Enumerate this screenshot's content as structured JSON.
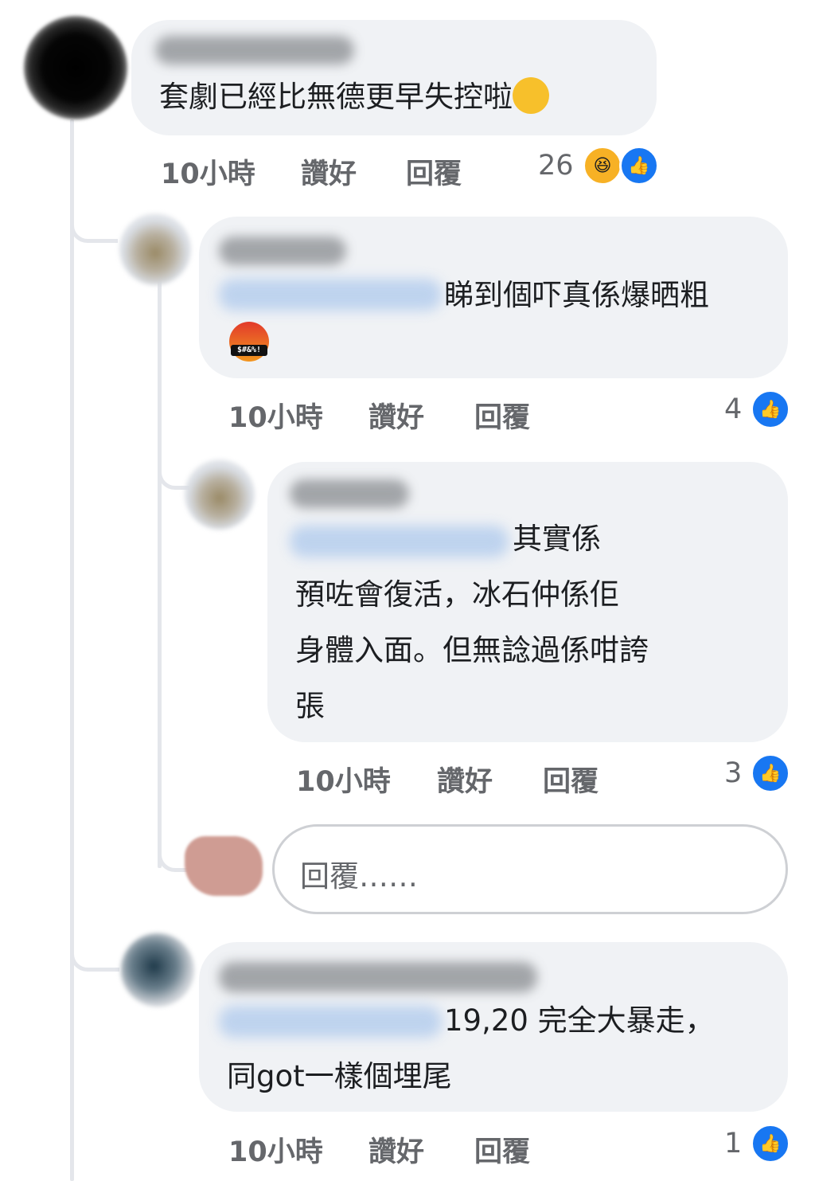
{
  "comments": [
    {
      "text_lines": [
        "套劇已經比無德更早失控啦"
      ],
      "trailing_emoji": "rolling-on-floor-laughing",
      "time": "10小時",
      "like_label": "讚好",
      "reply_label": "回覆",
      "reaction_count": "26",
      "reactions": [
        "haha",
        "like"
      ]
    },
    {
      "text_lines": [
        "睇到個吓真係爆晒粗"
      ],
      "trailing_emoji": "face-with-symbols",
      "emoji_text": "$#&%!",
      "time": "10小時",
      "like_label": "讚好",
      "reply_label": "回覆",
      "reaction_count": "4",
      "reactions": [
        "like"
      ]
    },
    {
      "text_lines": [
        "其實係",
        "預咗會￼復活，￼冰石仲係佢",
        "身體入面。但無諗過係咁￼誇",
        "張"
      ],
      "time": "10小時",
      "like_label": "讚好",
      "reply_label": "回覆",
      "reaction_count": "3",
      "reactions": [
        "like"
      ]
    },
    {
      "text_lines": [
        "19,20 完全大暴走，",
        "同got一樣個埋尾"
      ],
      "time": "10小時",
      "like_label": "讚好",
      "reply_label": "回覆",
      "reaction_count": "1",
      "reactions": [
        "like"
      ]
    }
  ],
  "reply_input": {
    "placeholder": "回覆……"
  },
  "colors": {
    "bubble": "#f0f2f5",
    "like_blue": "#1877f2",
    "meta_gray": "#65676b",
    "text": "#1c1e21"
  }
}
